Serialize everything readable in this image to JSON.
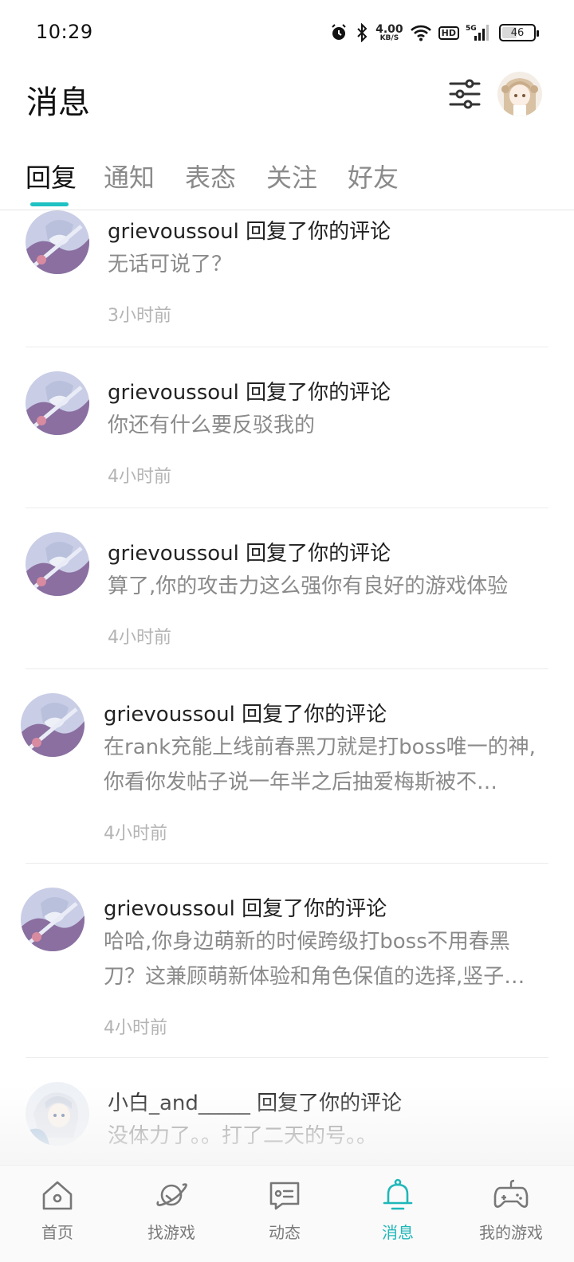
{
  "status_bar": {
    "time": "10:29",
    "net_speed_value": "4.00",
    "net_speed_unit": "KB/S",
    "hd": "HD",
    "signal": "5G",
    "battery": "46"
  },
  "header": {
    "title": "消息"
  },
  "tabs": [
    {
      "label": "回复",
      "active": true
    },
    {
      "label": "通知",
      "active": false
    },
    {
      "label": "表态",
      "active": false
    },
    {
      "label": "关注",
      "active": false
    },
    {
      "label": "好友",
      "active": false
    }
  ],
  "messages": [
    {
      "title": "grievoussoul 回复了你的评论",
      "body": "无话可说了？",
      "time": "3小时前"
    },
    {
      "title": "grievoussoul 回复了你的评论",
      "body": "你还有什么要反驳我的",
      "time": "4小时前"
    },
    {
      "title": "grievoussoul 回复了你的评论",
      "body": "算了,你的攻击力这么强你有良好的游戏体验",
      "time": "4小时前"
    },
    {
      "title": "grievoussoul 回复了你的评论",
      "body": "在rank充能上线前春黑刀就是打boss唯一的神,你看你发帖子说一年半之后抽爱梅斯被不…",
      "time": "4小时前"
    },
    {
      "title": "grievoussoul 回复了你的评论",
      "body": "哈哈,你身边萌新的时候跨级打boss不用春黑刀？这兼顾萌新体验和角色保值的选择,竖子…",
      "time": "4小时前"
    },
    {
      "title": "小白_and_____ 回复了你的评论",
      "body": "没体力了。。打了二天的号。。",
      "time": ""
    }
  ],
  "bottom_nav": [
    {
      "label": "首页",
      "icon": "home-icon"
    },
    {
      "label": "找游戏",
      "icon": "planet-icon"
    },
    {
      "label": "动态",
      "icon": "feed-icon"
    },
    {
      "label": "消息",
      "icon": "bell-icon"
    },
    {
      "label": "我的游戏",
      "icon": "gamepad-icon"
    }
  ],
  "colors": {
    "accent": "#1fc1c3",
    "text_primary": "#222222",
    "text_secondary": "#8a8a8a",
    "text_time": "#b4b4b4"
  }
}
